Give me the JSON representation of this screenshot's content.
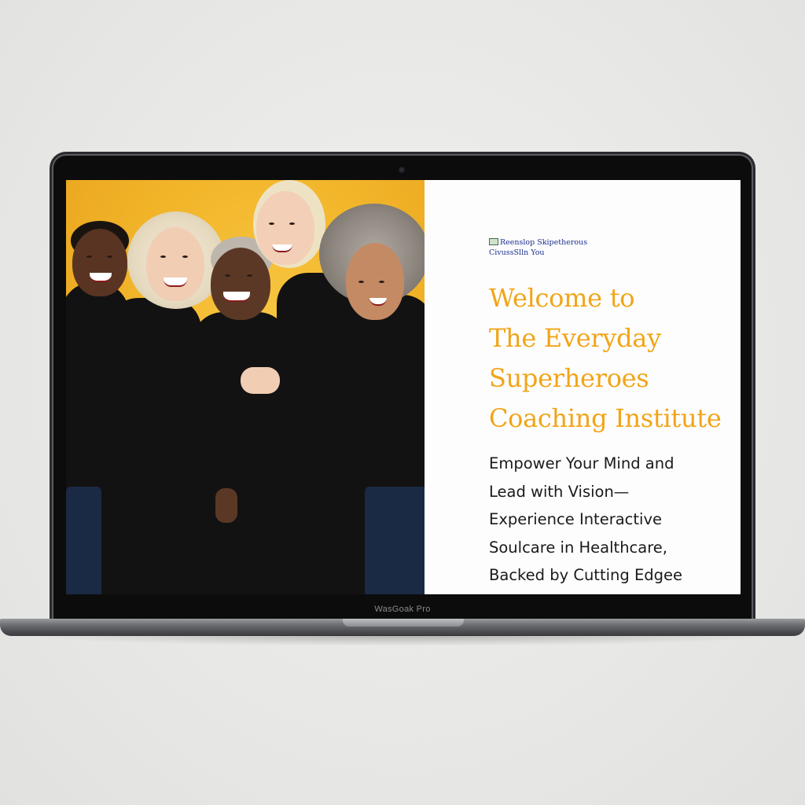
{
  "device": {
    "model_label": "WasGoak Pro"
  },
  "hero": {
    "image_alt": "Five smiling women in black outfits on a yellow background"
  },
  "brand": {
    "logo_line1": "Reenslop Skipetherous",
    "logo_line2": "CivussSlln You"
  },
  "headline": {
    "lines": [
      "Welcome to",
      "The Everyday",
      "Superheroes",
      "Coaching Institute"
    ]
  },
  "subtext": {
    "lines": [
      "Empower Your Mind and",
      "Lead with Vision—",
      "Experience Interactive",
      "Soulcare in Healthcare,",
      "Backed by Cutting Edgee"
    ]
  },
  "colors": {
    "accent": "#f2a417",
    "photo_background": "#f2b52a",
    "logo_text": "#1c2f8c"
  }
}
